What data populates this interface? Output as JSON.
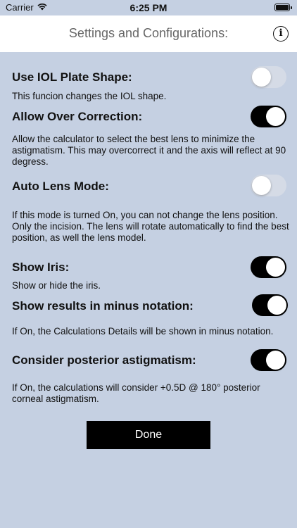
{
  "status_bar": {
    "carrier": "Carrier",
    "time": "6:25 PM"
  },
  "header": {
    "title": "Settings and Configurations:",
    "info_icon_glyph": "i"
  },
  "settings": [
    {
      "title": "Use IOL Plate Shape:",
      "description": "This funcion changes the IOL shape.",
      "enabled": false
    },
    {
      "title": "Allow Over Correction:",
      "description": "Allow the calculator to select the best lens to minimize the astigmatism. This may overcorrect it and the axis will reflect at 90 degress.",
      "enabled": true
    },
    {
      "title": "Auto Lens Mode:",
      "description": "If this mode is turned On, you can not change the lens position. Only the incision. The lens will rotate automatically to find the best position, as well the lens model.",
      "enabled": false
    },
    {
      "title": "Show Iris:",
      "description": "Show or hide the iris.",
      "enabled": true
    },
    {
      "title": "Show results in minus notation:",
      "description": "If On, the Calculations Details will be shown in minus notation.",
      "enabled": true
    },
    {
      "title": "Consider posterior astigmatism:",
      "description": "If On, the calculations will consider +0.5D @ 180° posterior corneal astigmatism.",
      "enabled": true
    }
  ],
  "done_label": "Done",
  "colors": {
    "background": "#c5d0e2",
    "switch_on": "#000000",
    "switch_off": "#d5dbe6",
    "button": "#000000"
  }
}
